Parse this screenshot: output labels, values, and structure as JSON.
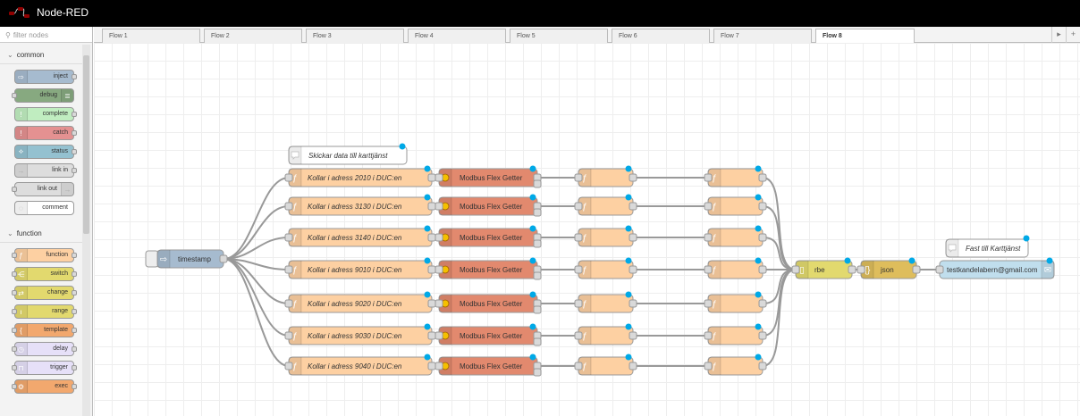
{
  "app": {
    "title": "Node-RED"
  },
  "palette": {
    "filter_placeholder": "filter nodes",
    "categories": [
      {
        "name": "common",
        "items": [
          "inject",
          "debug",
          "complete",
          "catch",
          "status",
          "link in",
          "link out",
          "comment"
        ]
      },
      {
        "name": "function",
        "items": [
          "function",
          "switch",
          "change",
          "range",
          "template",
          "delay",
          "trigger",
          "exec"
        ]
      }
    ]
  },
  "tabs": [
    "Flow 1",
    "Flow 2",
    "Flow 3",
    "Flow 4",
    "Flow 5",
    "Flow 6",
    "Flow 7",
    "Flow 8"
  ],
  "active_tab": "Flow 8",
  "flow": {
    "comment_top": "Skickar data till karttjänst",
    "comment_right": "Fast till Karttjänst",
    "inject_label": "timestamp",
    "rows": [
      {
        "function": "Kollar i adress 2010 i DUC:en",
        "modbus": "Modbus Flex Getter"
      },
      {
        "function": "Kollar i adress 3130 i DUC:en",
        "modbus": "Modbus Flex Getter"
      },
      {
        "function": "Kollar i adress 3140 i DUC:en",
        "modbus": "Modbus Flex Getter"
      },
      {
        "function": "Kollar i adress 9010 i DUC:en",
        "modbus": "Modbus Flex Getter"
      },
      {
        "function": "Kollar i adress 9020 i DUC:en",
        "modbus": "Modbus Flex Getter"
      },
      {
        "function": "Kollar i adress 9030 i DUC:en",
        "modbus": "Modbus Flex Getter"
      },
      {
        "function": "Kollar i adress 9040 i DUC:en",
        "modbus": "Modbus Flex Getter"
      }
    ],
    "rbe_label": "rbe",
    "json_label": "json",
    "email_label": "testkandelabern@gmail.com"
  },
  "colors": {
    "function": "#fdd0a2",
    "modbus": "#e2896e",
    "inject": "#a6bbcf",
    "rbe": "#e2d96e",
    "json": "#debd5c",
    "email": "#c0deed",
    "changed_badge": "#00a9e7"
  }
}
